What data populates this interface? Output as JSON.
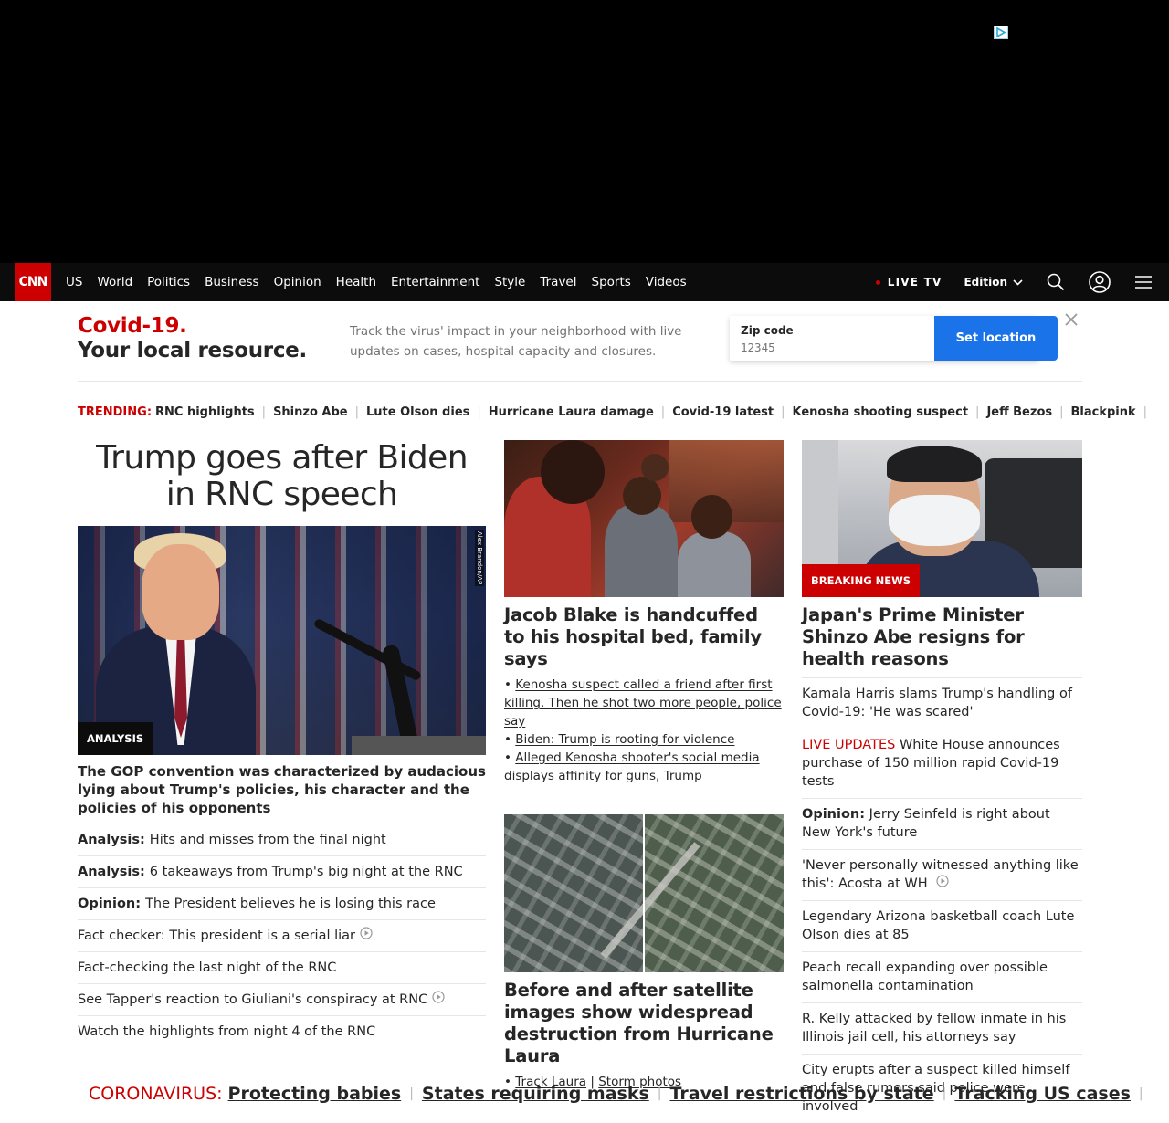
{
  "nav": {
    "logo": "CNN",
    "links": [
      "US",
      "World",
      "Politics",
      "Business",
      "Opinion",
      "Health",
      "Entertainment",
      "Style",
      "Travel",
      "Sports",
      "Videos"
    ],
    "live_tv": "LIVE TV",
    "edition": "Edition"
  },
  "covid_banner": {
    "title_red": "Covid-19.",
    "title_dark": "Your local resource.",
    "description": "Track the virus' impact in your neighborhood with live updates on cases, hospital capacity and closures.",
    "zip_label": "Zip code",
    "zip_placeholder": "12345",
    "button": "Set location"
  },
  "trending": {
    "label": "TRENDING:",
    "items": [
      "RNC highlights",
      "Shinzo Abe",
      "Lute Olson dies",
      "Hurricane Laura damage",
      "Covid-19 latest",
      "Kenosha shooting suspect",
      "Jeff Bezos",
      "Blackpink"
    ]
  },
  "lead": {
    "headline": "Trump goes after Biden in RNC speech",
    "image_tag": "ANALYSIS",
    "photo_credit": "Alex Brandon/AP",
    "subheadline": "The GOP convention was characterized by audacious lying about Trump's policies, his character and the policies of his opponents",
    "list": [
      {
        "prefix": "Analysis:",
        "text": "Hits and misses from the final night",
        "video": false
      },
      {
        "prefix": "Analysis:",
        "text": "6 takeaways from Trump's big night at the RNC",
        "video": false
      },
      {
        "prefix": "Opinion:",
        "text": "The President believes he is losing this race",
        "video": false
      },
      {
        "prefix": "",
        "text": "Fact checker: This president is a serial liar",
        "video": true
      },
      {
        "prefix": "",
        "text": "Fact-checking the last night of the RNC",
        "video": false
      },
      {
        "prefix": "",
        "text": "See Tapper's reaction to Giuliani's conspiracy at RNC",
        "video": true
      },
      {
        "prefix": "",
        "text": "Watch the highlights from night 4 of the RNC",
        "video": false
      }
    ]
  },
  "col2": {
    "story1": {
      "headline": "Jacob Blake is handcuffed to his hospital bed, family says",
      "bullets": [
        "Kenosha suspect called a friend after first killing. Then he shot two more people, police say",
        "Biden: Trump is rooting for violence",
        "Alleged Kenosha shooter's social media displays affinity for guns, Trump"
      ]
    },
    "story2": {
      "headline": "Before and after satellite images show widespread destruction from Hurricane Laura",
      "links": [
        "Track Laura",
        "Storm photos"
      ],
      "link_sep": "|"
    }
  },
  "col3": {
    "image_tag": "BREAKING NEWS",
    "headline": "Japan's Prime Minister Shinzo Abe resigns for health reasons",
    "list": [
      {
        "prefix": "",
        "live": "",
        "text": "Kamala Harris slams Trump's handling of Covid-19: 'He was scared'",
        "video": false
      },
      {
        "prefix": "",
        "live": "LIVE UPDATES",
        "text": "White House announces purchase of 150 million rapid Covid-19 tests",
        "video": false
      },
      {
        "prefix": "Opinion:",
        "live": "",
        "text": "Jerry Seinfeld is right about New York's future",
        "video": false
      },
      {
        "prefix": "",
        "live": "",
        "text": "'Never personally witnessed anything like this': Acosta at WH",
        "video": true
      },
      {
        "prefix": "",
        "live": "",
        "text": "Legendary Arizona basketball coach Lute Olson dies at 85",
        "video": false
      },
      {
        "prefix": "",
        "live": "",
        "text": "Peach recall expanding over possible salmonella contamination",
        "video": false
      },
      {
        "prefix": "",
        "live": "",
        "text": "R. Kelly attacked by fellow inmate in his Illinois jail cell, his attorneys say",
        "video": false
      },
      {
        "prefix": "",
        "live": "",
        "text": "City erupts after a suspect killed himself and false rumors said police were involved",
        "video": false
      }
    ]
  },
  "coronavirus": {
    "label": "CORONAVIRUS:",
    "items": [
      "Protecting babies",
      "States requiring masks",
      "Travel restrictions by state",
      "Tracking US cases"
    ]
  },
  "colors": {
    "cnn_red": "#cc0000",
    "nav_bg": "#0c0c0c",
    "button_blue": "#1a73e8"
  },
  "icons": [
    "adchoices-icon",
    "search-icon",
    "account-icon",
    "menu-icon",
    "close-icon",
    "play-icon",
    "chevron-down-icon"
  ]
}
